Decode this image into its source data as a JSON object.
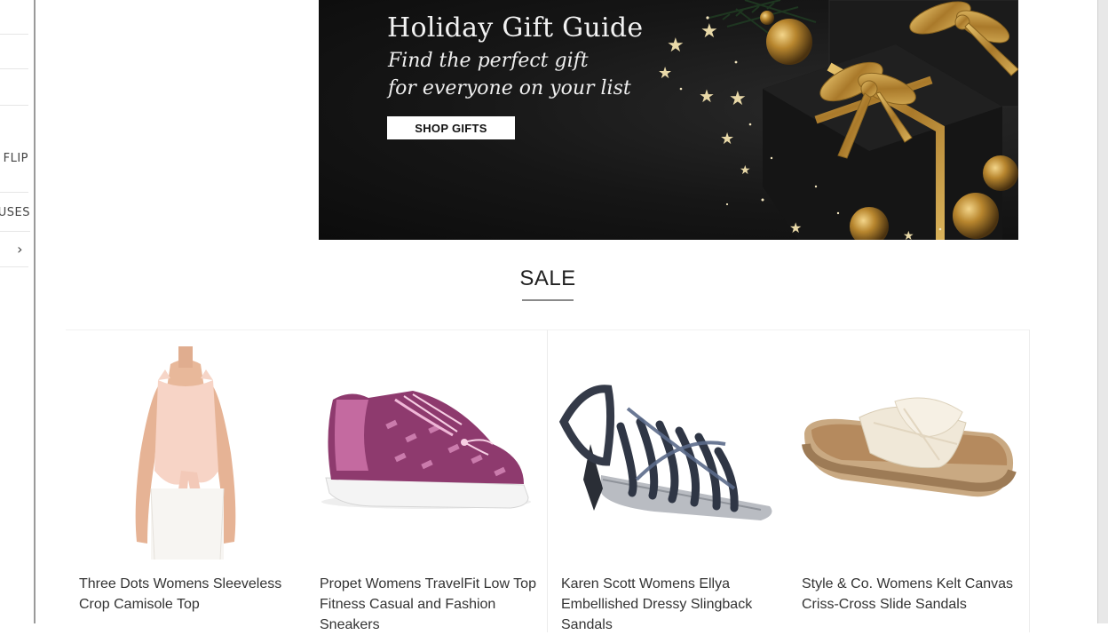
{
  "sidebar": {
    "items": [
      {
        "label": ""
      },
      {
        "label": ""
      },
      {
        "label": ""
      },
      {
        "label": "FLIP"
      },
      {
        "label": "USES"
      },
      {
        "label": "›"
      }
    ]
  },
  "banner": {
    "title": "Holiday Gift Guide",
    "subtitle_line1": "Find the perfect gift",
    "subtitle_line2": "for everyone on your list",
    "button_label": "SHOP GIFTS"
  },
  "sale": {
    "heading": "SALE",
    "products": [
      {
        "name": "Three Dots Womens Sleeveless Crop Camisole Top",
        "image": "pink-camisole-top"
      },
      {
        "name": "Propet Womens TravelFit Low Top Fitness Casual and Fashion Sneakers",
        "image": "purple-sneaker"
      },
      {
        "name": "Karen Scott Womens Ellya Embellished Dressy Slingback Sandals",
        "image": "navy-slingback-sandal"
      },
      {
        "name": "Style & Co. Womens Kelt Canvas Criss-Cross Slide Sandals",
        "image": "canvas-slide-sandal"
      }
    ]
  },
  "colors": {
    "banner_bg": "#141414",
    "gold_accent": "#c9a24a",
    "text": "#333333"
  }
}
